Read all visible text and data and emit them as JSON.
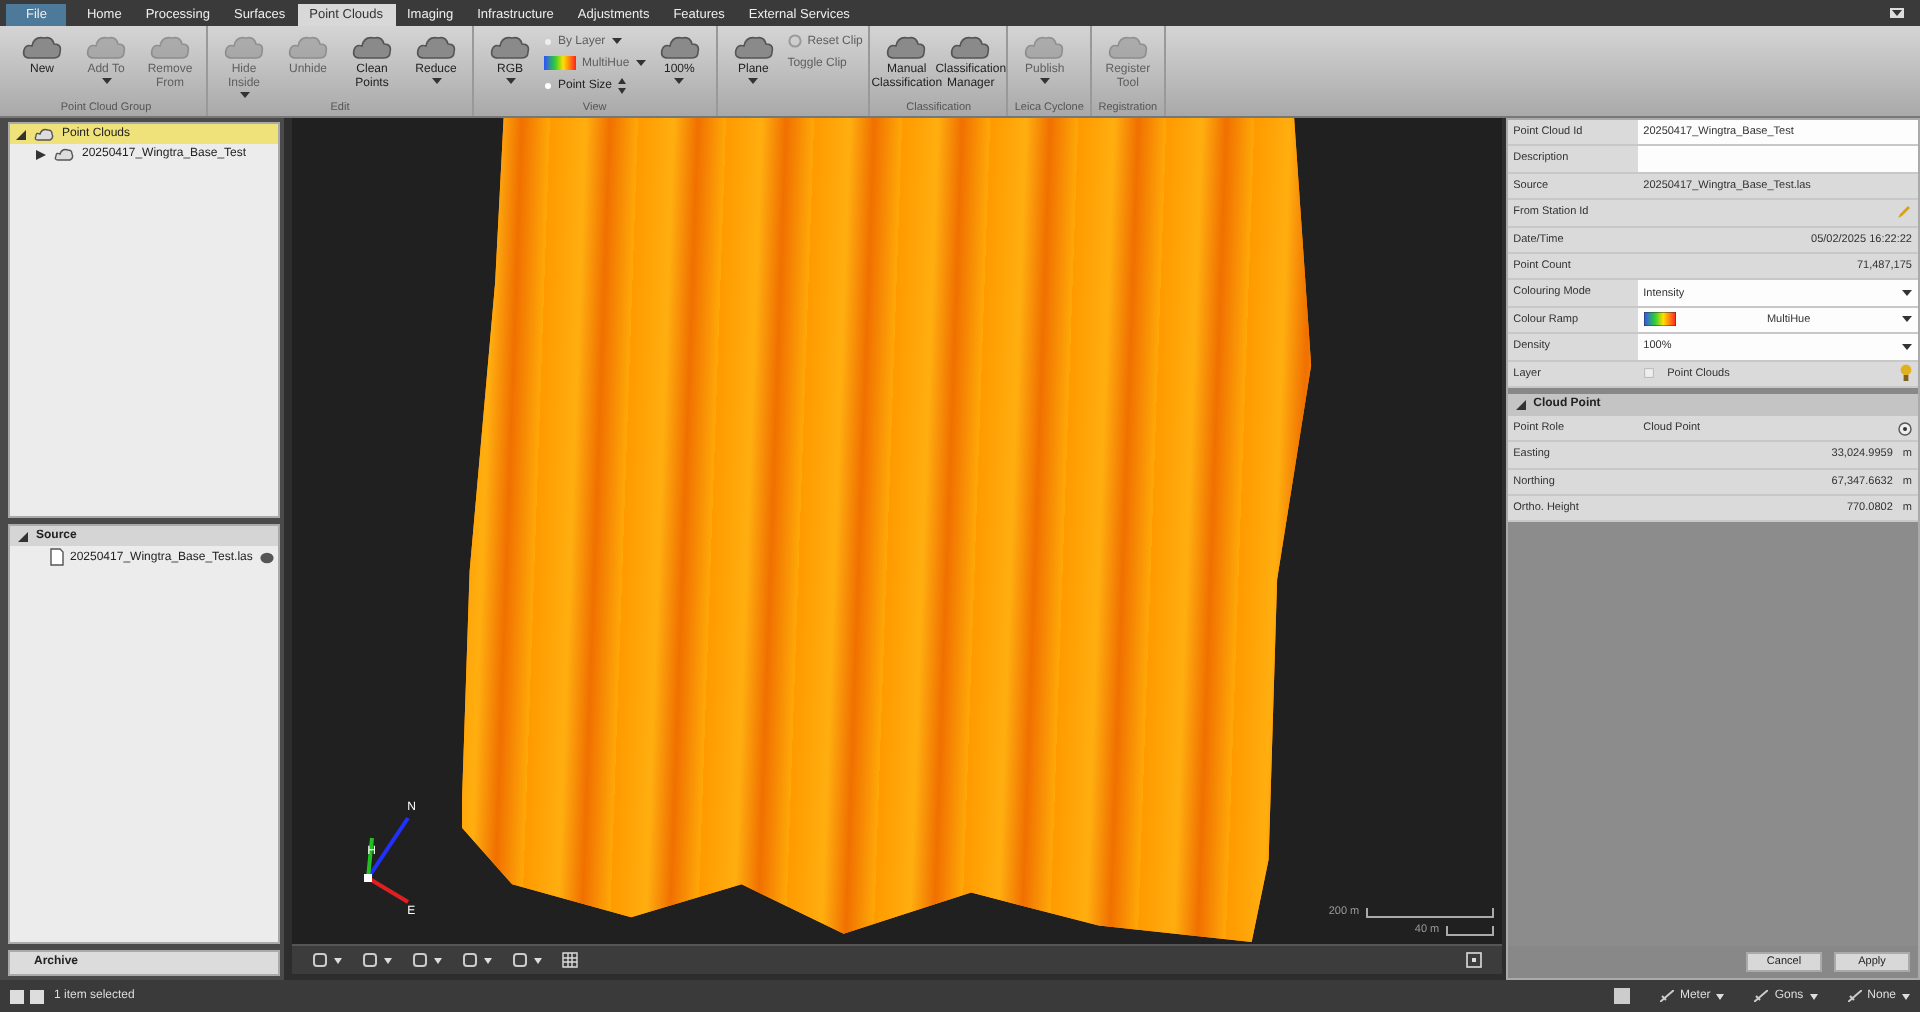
{
  "tabs": [
    {
      "label": "File",
      "selected": false,
      "kind": "file"
    },
    {
      "label": "Home",
      "selected": false,
      "kind": "tab"
    },
    {
      "label": "Processing",
      "selected": false,
      "kind": "tab"
    },
    {
      "label": "Surfaces",
      "selected": false,
      "kind": "tab"
    },
    {
      "label": "Point Clouds",
      "selected": true,
      "kind": "tab"
    },
    {
      "label": "Imaging",
      "selected": false,
      "kind": "tab"
    },
    {
      "label": "Infrastructure",
      "selected": false,
      "kind": "tab"
    },
    {
      "label": "Adjustments",
      "selected": false,
      "kind": "tab"
    },
    {
      "label": "Features",
      "selected": false,
      "kind": "tab"
    },
    {
      "label": "External Services",
      "selected": false,
      "kind": "tab"
    }
  ],
  "ribbon": [
    {
      "group": "Point Cloud Group",
      "items": [
        {
          "kind": "large",
          "label": "New",
          "disabled": false,
          "dropdown": false
        },
        {
          "kind": "large",
          "label": "Add To",
          "disabled": true,
          "dropdown": true
        },
        {
          "kind": "large",
          "label": "Remove From",
          "disabled": true,
          "dropdown": false
        }
      ]
    },
    {
      "group": "Edit",
      "items": [
        {
          "kind": "large",
          "label": "Hide Inside",
          "disabled": true,
          "dropdown": true
        },
        {
          "kind": "large",
          "label": "Unhide",
          "disabled": true,
          "dropdown": false
        },
        {
          "kind": "large",
          "label": "Clean Points",
          "disabled": false,
          "dropdown": false
        },
        {
          "kind": "large",
          "label": "Reduce",
          "disabled": false,
          "dropdown": true
        }
      ]
    },
    {
      "group": "View",
      "items": [
        {
          "kind": "large",
          "label": "RGB",
          "disabled": false,
          "dropdown": true
        },
        {
          "kind": "stack",
          "rows": [
            {
              "kind": "select",
              "label": "By Layer",
              "disabled": true
            },
            {
              "kind": "ramp",
              "label": "MultiHue",
              "disabled": true
            },
            {
              "kind": "spin",
              "label": "Point Size",
              "disabled": false
            }
          ]
        },
        {
          "kind": "large",
          "label": "100%",
          "disabled": false,
          "dropdown": true
        }
      ]
    },
    {
      "items": [
        {
          "kind": "large",
          "label": "Plane",
          "disabled": false,
          "dropdown": true
        },
        {
          "kind": "stack",
          "rows": [
            {
              "kind": "clip",
              "label": "Reset Clip",
              "disabled": true
            },
            {
              "kind": "plain",
              "label": "Toggle Clip",
              "disabled": true
            }
          ]
        }
      ]
    },
    {
      "group": "Classification",
      "items": [
        {
          "kind": "large",
          "label": "Manual Classification",
          "disabled": false,
          "dropdown": false
        },
        {
          "kind": "large",
          "label": "Classification Manager",
          "disabled": false,
          "dropdown": false
        }
      ]
    },
    {
      "group": "Leica Cyclone",
      "items": [
        {
          "kind": "large",
          "label": "Publish",
          "disabled": true,
          "dropdown": true
        }
      ]
    },
    {
      "group": "Registration",
      "items": [
        {
          "kind": "large",
          "label": "Register Tool",
          "disabled": true,
          "dropdown": false
        }
      ]
    }
  ],
  "explorer": {
    "tree": [
      {
        "label": "Point Clouds",
        "selected": true,
        "expanded": true,
        "children": [
          {
            "label": "20250417_Wingtra_Base_Test",
            "selected": false,
            "expanded": false
          }
        ]
      }
    ],
    "source": {
      "title": "Source",
      "items": [
        "20250417_Wingtra_Base_Test.las"
      ]
    },
    "archive": "Archive"
  },
  "viewport": {
    "compass": [
      "N",
      "H",
      "E"
    ],
    "scales": [
      "200 m",
      "40 m"
    ]
  },
  "properties": {
    "rows": [
      {
        "label": "Point Cloud Id",
        "value": "20250417_Wingtra_Base_Test",
        "kind": "text",
        "editable": true
      },
      {
        "label": "Description",
        "value": "",
        "kind": "text",
        "editable": true
      },
      {
        "label": "Source",
        "value": "20250417_Wingtra_Base_Test.las",
        "kind": "text",
        "editable": false
      },
      {
        "label": "From Station Id",
        "value": "",
        "kind": "pick",
        "editable": false
      },
      {
        "label": "Date/Time",
        "value": "05/02/2025 16:22:22",
        "kind": "number",
        "editable": false
      },
      {
        "label": "Point Count",
        "value": "71,487,175",
        "kind": "number",
        "editable": false
      },
      {
        "label": "Colouring Mode",
        "value": "Intensity",
        "kind": "select",
        "editable": true
      },
      {
        "label": "Colour Ramp",
        "value": "MultiHue",
        "kind": "ramp",
        "editable": true
      },
      {
        "label": "Density",
        "value": "100%",
        "kind": "select",
        "editable": true
      },
      {
        "label": "Layer",
        "value": "Point Clouds",
        "kind": "layer",
        "editable": false
      }
    ],
    "section": {
      "title": "Cloud Point",
      "expanded": true
    },
    "point": [
      {
        "label": "Point Role",
        "value": "Cloud Point",
        "kind": "target"
      },
      {
        "label": "Easting",
        "value": "33,024.9959",
        "kind": "number",
        "unit": "m"
      },
      {
        "label": "Northing",
        "value": "67,347.6632",
        "kind": "number",
        "unit": "m"
      },
      {
        "label": "Ortho. Height",
        "value": "770.0802",
        "kind": "number",
        "unit": "m"
      }
    ],
    "buttons": [
      "Cancel",
      "Apply"
    ]
  },
  "status": {
    "text": "1 item selected",
    "units": [
      "Meter",
      "Gons",
      "None"
    ]
  }
}
